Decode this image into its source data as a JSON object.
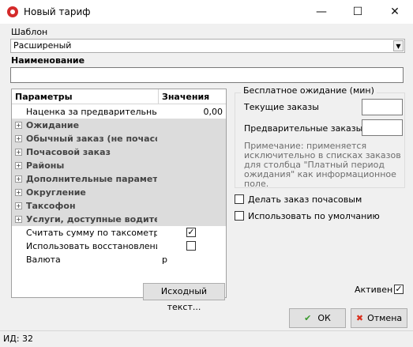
{
  "window": {
    "title": "Новый тариф",
    "minimize": "—",
    "maximize": "☐",
    "close": "✕"
  },
  "template": {
    "label": "Шаблон",
    "selected": "Расширеный"
  },
  "name_field": {
    "label": "Наименование",
    "value": ""
  },
  "params_grid": {
    "col_params": "Параметры",
    "col_values": "Значения",
    "rows": [
      {
        "name": "Наценка за предварительный заказ",
        "value": "0,00"
      },
      {
        "name": "Ожидание"
      },
      {
        "name": "Обычный заказ (не почасовой)"
      },
      {
        "name": "Почасовой заказ"
      },
      {
        "name": "Районы"
      },
      {
        "name": "Дополнительные параметры"
      },
      {
        "name": "Округление"
      },
      {
        "name": "Таксофон"
      },
      {
        "name": "Услуги, доступные водителям"
      },
      {
        "name": "Считать сумму по таксометру",
        "checked": "✓"
      },
      {
        "name": "Использовать восстановление км"
      },
      {
        "name": "Валюта",
        "value": "р"
      }
    ],
    "expand_glyph": "+"
  },
  "free_wait": {
    "legend": "Бесплатное ожидание (мин)",
    "current_label": "Текущие заказы",
    "current_value": "",
    "preliminary_label": "Предварительные заказы",
    "preliminary_value": "",
    "note": "Примечание: применяется исключительно в списках заказов для столбца \"Платный период ожидания\" как информационное поле."
  },
  "options": {
    "hourly_label": "Делать заказ почасовым",
    "default_label": "Использовать по умолчанию",
    "active_label": "Активен",
    "active_mark": "✓"
  },
  "buttons": {
    "source_text": "Исходный текст...",
    "ok": "ОК",
    "cancel": "Отмена",
    "ok_icon": "✔",
    "cancel_icon": "✖"
  },
  "status": {
    "id_text": "ИД: 32"
  },
  "colors": {
    "ok_icon": "#3a9a2e",
    "cancel_icon": "#d9301e",
    "app_icon": "#d42a2a"
  }
}
